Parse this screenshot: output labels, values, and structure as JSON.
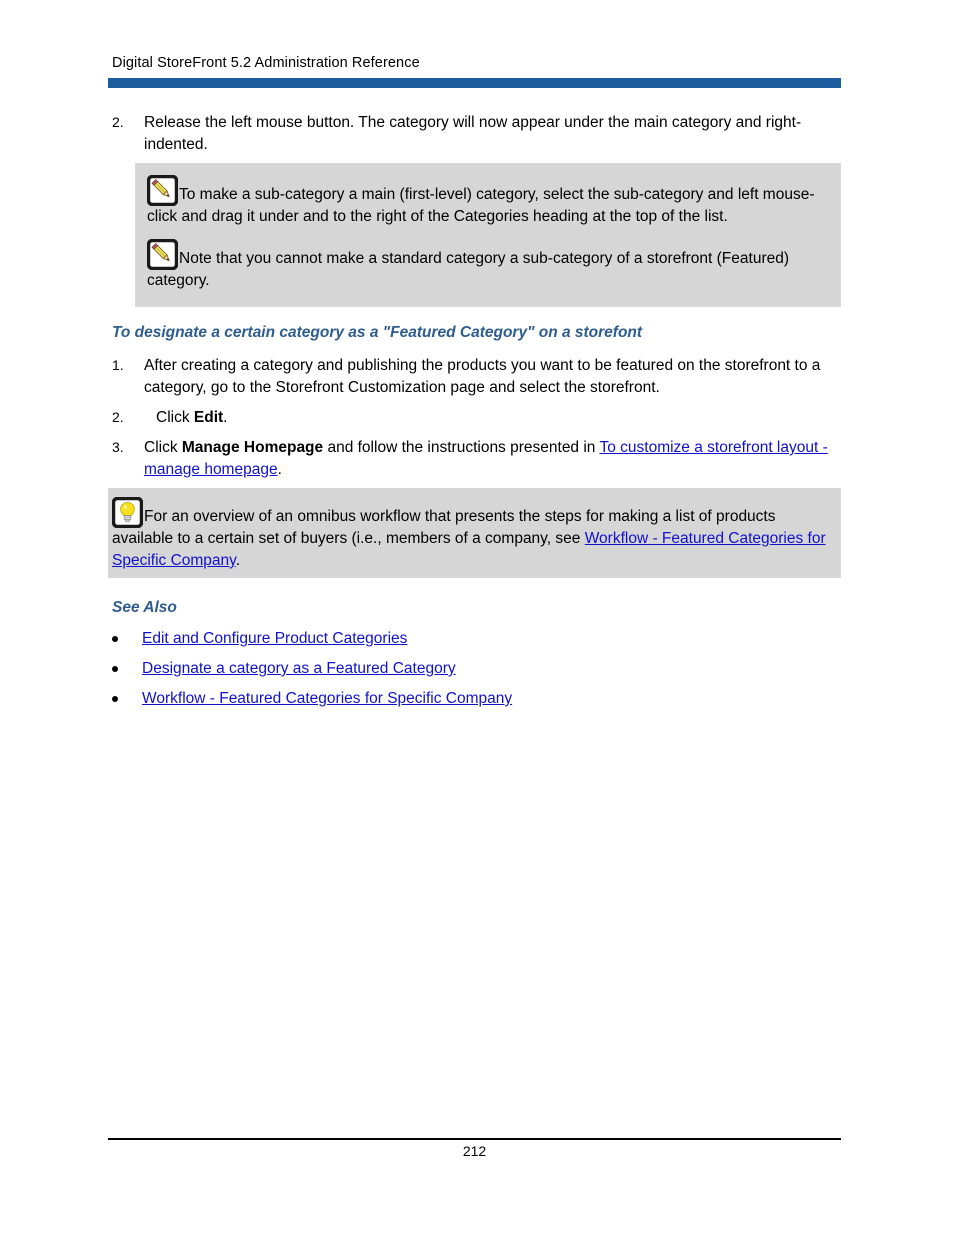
{
  "header": {
    "title": "Digital StoreFront 5.2 Administration Reference",
    "rule_color": "#1b5d9e"
  },
  "steps_top": [
    {
      "marker": "2.",
      "text": "Release the left mouse button. The category will now appear under the main category and right-indented."
    }
  ],
  "note_box": {
    "icon": "note-pencil-icon",
    "notes": [
      {
        "icon": "note-pencil-icon",
        "text": "To make a sub-category a main (first-level) category, select the sub-category and left mouse-click and drag it under and to the right of the Categories heading at the top of the list."
      },
      {
        "icon": "note-pencil-icon",
        "text": "Note that you cannot make a standard category a sub-category of a storefront (Featured) category."
      }
    ],
    "background": "#d6d6d6"
  },
  "section": {
    "heading": "To designate a certain category as a \"Featured Category\" on a storefont",
    "heading_color": "#2d5c8e",
    "steps": [
      {
        "marker": "1.",
        "text_before": "After creating a category and publishing the products you want to be featured on the storefront to a category, go to the Storefront Customization page and select the storefront.",
        "bold": "",
        "text_after": "",
        "link": "",
        "tail": ""
      },
      {
        "marker": "2.",
        "text_before": "Click ",
        "bold": "Edit",
        "text_after": "",
        "link": "",
        "tail": "."
      },
      {
        "marker": "3.",
        "text_before": "Click ",
        "bold": "Manage Homepage",
        "text_after": " and follow the instructions presented in ",
        "link": "To customize a storefront layout - manage homepage",
        "tail": "."
      }
    ]
  },
  "tip_box": {
    "icon": "lightbulb-tip-icon",
    "text_before": "For an overview of an omnibus workflow that presents the steps for making a list of products available to a certain set of buyers (i.e., members of a company, see ",
    "link": "Workflow - Featured Categories for Specific Company",
    "tail": ".",
    "background": "#d6d6d6"
  },
  "see_also": {
    "heading": "See Also",
    "heading_color": "#2d5c8e",
    "links": [
      "Edit and Configure Product Categories",
      "Designate a category as a Featured Category",
      "Workflow - Featured Categories for Specific Company"
    ]
  },
  "footer": {
    "page_number": "212"
  },
  "colors": {
    "link": "#1111cc",
    "header_bar": "#1b5d9e",
    "callout_bg": "#d6d6d6",
    "heading_blue": "#2d5c8e"
  }
}
